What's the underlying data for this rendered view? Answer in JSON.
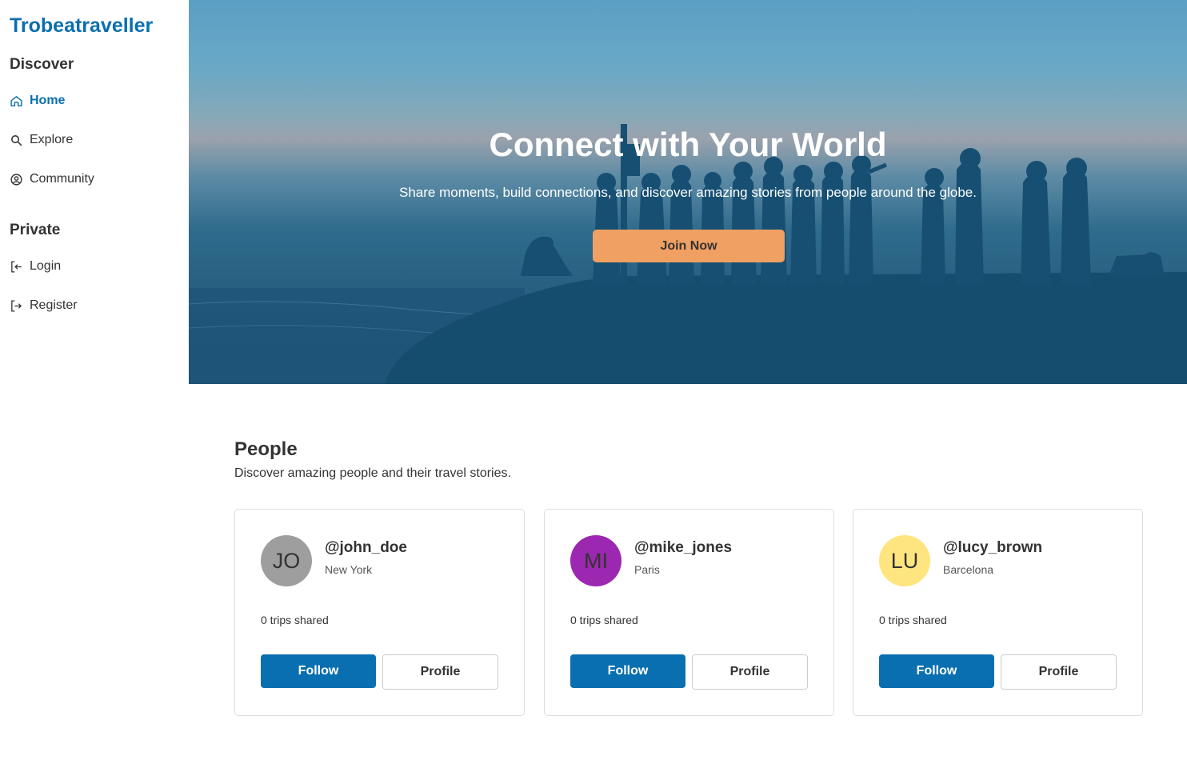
{
  "app": {
    "brand": "Trobeatraveller"
  },
  "sidebar": {
    "sections": [
      {
        "title": "Discover",
        "items": [
          {
            "label": "Home",
            "icon": "home-icon",
            "active": true
          },
          {
            "label": "Explore",
            "icon": "search-icon",
            "active": false
          },
          {
            "label": "Community",
            "icon": "community-icon",
            "active": false
          }
        ]
      },
      {
        "title": "Private",
        "items": [
          {
            "label": "Login",
            "icon": "login-icon",
            "active": false
          },
          {
            "label": "Register",
            "icon": "register-icon",
            "active": false
          }
        ]
      }
    ]
  },
  "hero": {
    "title": "Connect with Your World",
    "subtitle": "Share moments, build connections, and discover amazing stories from people around the globe.",
    "cta_label": "Join Now"
  },
  "people": {
    "title": "People",
    "subtitle": "Discover amazing people and their travel stories.",
    "cards": [
      {
        "initials": "JO",
        "avatar_color": "#9e9e9e",
        "username": "@john_doe",
        "location": "New York",
        "trips": "0 trips shared",
        "follow_label": "Follow",
        "profile_label": "Profile"
      },
      {
        "initials": "MI",
        "avatar_color": "#9c27b0",
        "username": "@mike_jones",
        "location": "Paris",
        "trips": "0 trips shared",
        "follow_label": "Follow",
        "profile_label": "Profile"
      },
      {
        "initials": "LU",
        "avatar_color": "#ffe57f",
        "username": "@lucy_brown",
        "location": "Barcelona",
        "trips": "0 trips shared",
        "follow_label": "Follow",
        "profile_label": "Profile"
      }
    ]
  },
  "colors": {
    "accent": "#0a6fb0",
    "cta": "#f0a062"
  }
}
